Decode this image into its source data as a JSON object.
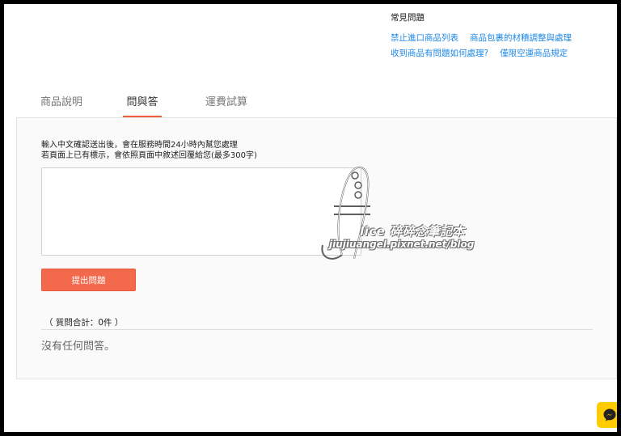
{
  "faq": {
    "title": "常見問題",
    "links": [
      [
        "禁止進口商品列表",
        "商品包裹的材積調整與處理"
      ],
      [
        "收到商品有問題如何處理?",
        "僅限空運商品規定"
      ]
    ]
  },
  "tabs": [
    {
      "label": "商品說明",
      "active": false
    },
    {
      "label": "問與答",
      "active": true
    },
    {
      "label": "運費試算",
      "active": false
    }
  ],
  "qa": {
    "hint_line1": "輸入中文確認送出後，會在服務時間24小時內幫您處理",
    "hint_line2": "若頁面上已有標示，會依照頁面中敘述回覆給您(最多300字)",
    "input_value": "",
    "submit_label": "提出問題",
    "count_label": "（ 質問合計：0件 ）",
    "empty_text": "沒有任何問答。"
  },
  "watermark": {
    "brand": "lice 碎碎念筆記本",
    "url": "jiujiuangel.pixnet.net/blog"
  },
  "colors": {
    "accent": "#f3694c",
    "link": "#1e88e5",
    "messenger": "#ffcc00"
  },
  "icons": {
    "messenger": "messenger-icon"
  }
}
